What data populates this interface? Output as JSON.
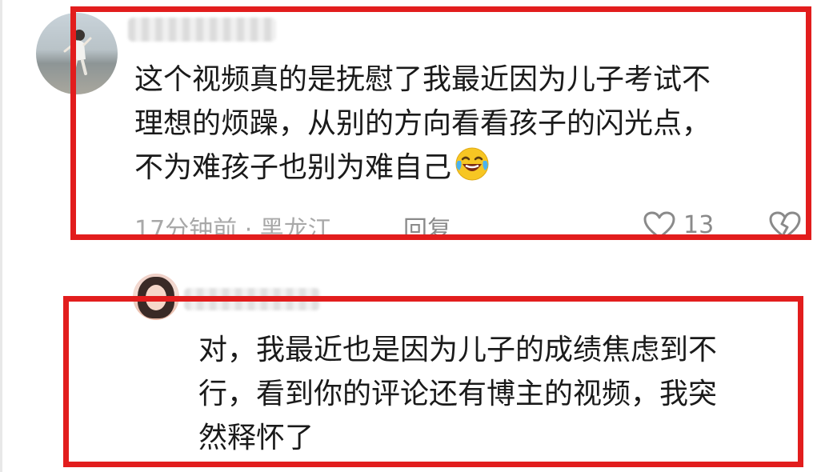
{
  "comments": [
    {
      "username": "",
      "text_lines": [
        "这个视频真的是抚慰了我最近因为儿子考试不",
        "理想的烦躁，从别的方向看看孩子的闪光点，",
        "不为难孩子也别为难自己"
      ],
      "emoji": "laughing-crying-emoji",
      "meta": "17分钟前 · 黑龙江",
      "reply_label": "回复",
      "like_count": "13",
      "avatar": "beach-photo-avatar"
    },
    {
      "username": "",
      "text_lines": [
        "对，我最近也是因为儿子的成绩焦虑到不",
        "行，看到你的评论还有博主的视频，我突",
        "然释怀了"
      ],
      "avatar": "girl-photo-avatar"
    }
  ],
  "highlight": {
    "color": "#e21d1d"
  },
  "icons": {
    "like": "heart-outline-icon",
    "dislike": "broken-heart-icon"
  }
}
